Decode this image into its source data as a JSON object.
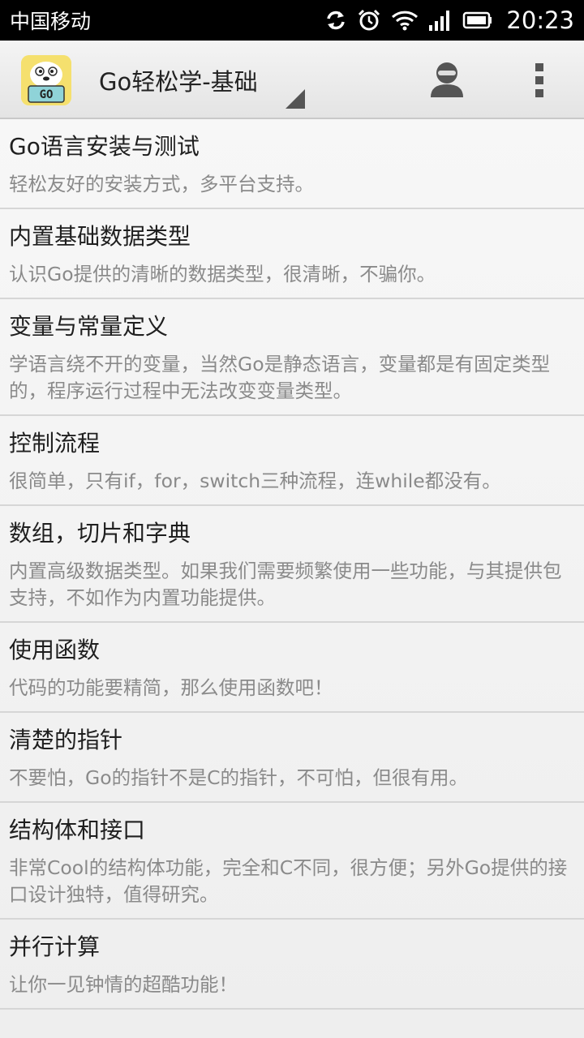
{
  "status_bar": {
    "carrier": "中国移动",
    "time": "20:23",
    "icons": [
      "sync-icon",
      "alarm-icon",
      "wifi-icon",
      "signal-icon",
      "battery-icon"
    ]
  },
  "action_bar": {
    "title": "Go轻松学-基础",
    "logo_text": "GO",
    "icons": [
      "app-logo-icon",
      "spinner-indicator-icon",
      "account-icon",
      "overflow-menu-icon"
    ]
  },
  "lessons": [
    {
      "title": "Go语言安装与测试",
      "desc": "轻松友好的安装方式，多平台支持。"
    },
    {
      "title": "内置基础数据类型",
      "desc": "认识Go提供的清晰的数据类型，很清晰，不骗你。"
    },
    {
      "title": "变量与常量定义",
      "desc": "学语言绕不开的变量，当然Go是静态语言，变量都是有固定类型的，程序运行过程中无法改变变量类型。"
    },
    {
      "title": "控制流程",
      "desc": "很简单，只有if，for，switch三种流程，连while都没有。"
    },
    {
      "title": "数组，切片和字典",
      "desc": "内置高级数据类型。如果我们需要频繁使用一些功能，与其提供包支持，不如作为内置功能提供。"
    },
    {
      "title": "使用函数",
      "desc": "代码的功能要精简，那么使用函数吧！"
    },
    {
      "title": "清楚的指针",
      "desc": "不要怕，Go的指针不是C的指针，不可怕，但很有用。"
    },
    {
      "title": "结构体和接口",
      "desc": "非常Cool的结构体功能，完全和C不同，很方便；另外Go提供的接口设计独特，值得研究。"
    },
    {
      "title": "并行计算",
      "desc": "让你一见钟情的超酷功能！"
    }
  ]
}
